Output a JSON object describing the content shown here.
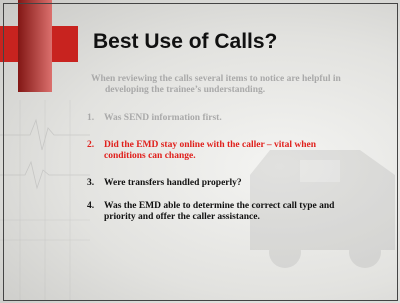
{
  "slide": {
    "title": "Best Use of Calls?",
    "intro": {
      "line1": "When reviewing the calls several items to notice are helpful in",
      "line2": "developing the trainee’s understanding."
    },
    "items": [
      {
        "num": "1.",
        "lines": [
          "Was SEND information first."
        ]
      },
      {
        "num": "2.",
        "lines": [
          "Did the EMD stay online with the caller – vital when",
          "conditions can change."
        ]
      },
      {
        "num": "3.",
        "lines": [
          "Were transfers handled properly?"
        ]
      },
      {
        "num": "4.",
        "lines": [
          "Was the EMD able to determine the correct call type and",
          "priority and offer the caller assistance."
        ]
      }
    ],
    "colors": {
      "accent_red": "#e0201c",
      "muted_gray": "#a9a9a9",
      "text_dark": "#111111",
      "cross_red": "#c8231f"
    }
  }
}
